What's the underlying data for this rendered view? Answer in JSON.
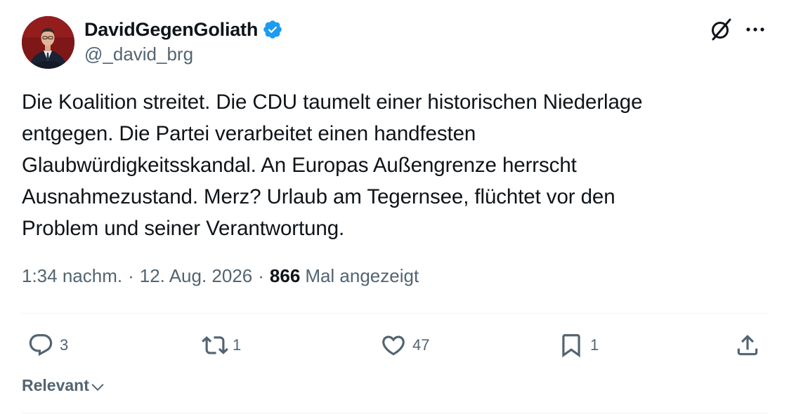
{
  "author": {
    "display_name": "DavidGegenGoliath",
    "handle": "@_david_brg",
    "verified": true
  },
  "tweet": {
    "text": "Die Koalition streitet. Die CDU taumelt einer historischen Niederlage\nentgegen. Die Partei verarbeitet einen handfesten\nGlaubwürdigkeitsskandal. An Europas Außengrenze herrscht\nAusnahmezustand. Merz? Urlaub am Tegernsee, flüchtet vor den\nProblem und seiner Verantwortung.",
    "time": "1:34 nachm.",
    "date": "12. Aug. 2026",
    "separator": "·",
    "views_count": "866",
    "views_label": "Mal angezeigt"
  },
  "actions": {
    "reply_count": "3",
    "repost_count": "1",
    "like_count": "47",
    "bookmark_count": "1"
  },
  "sort": {
    "label": "Relevant"
  },
  "icons": {
    "verified": "verified-badge-icon",
    "grok": "grok-icon",
    "more": "more-icon",
    "reply": "reply-icon",
    "repost": "repost-icon",
    "like": "heart-icon",
    "bookmark": "bookmark-icon",
    "share": "share-icon",
    "sort": "chevron-down-icon"
  },
  "colors": {
    "text_primary": "#0f1419",
    "text_secondary": "#536471",
    "verified_blue": "#1d9bf0",
    "divider": "#eff3f4"
  }
}
